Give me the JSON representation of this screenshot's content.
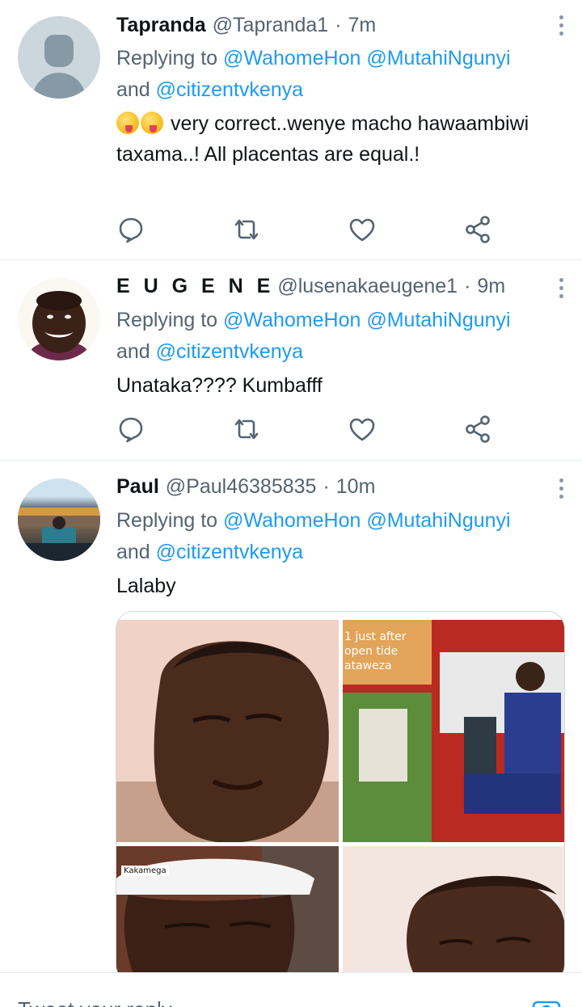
{
  "colors": {
    "accent": "#1d9bf0",
    "muted": "#536471",
    "text": "#0f1419",
    "divider": "#e6ecf0"
  },
  "tweets": [
    {
      "name": "Tapranda",
      "handle": "@Tapranda1",
      "dot": "·",
      "time": "7m",
      "reply_prefix": "Replying to",
      "mention1": "@WahomeHon",
      "mention2": "@MutahiNgunyi",
      "reply_and": "and",
      "mention3": "@citizentvkenya",
      "text": "very correct..wenye macho hawaambiwi taxama..! All placentas are equal.!",
      "emojis": [
        "yum-face-emoji",
        "yum-face-emoji"
      ]
    },
    {
      "name": "E U G E N E",
      "handle": "@lusenakaeugene1",
      "dot": "·",
      "time": "9m",
      "reply_prefix": "Replying to",
      "mention1": "@WahomeHon",
      "mention2": "@MutahiNgunyi",
      "reply_and": "and",
      "mention3": "@citizentvkenya",
      "text": "Unataka???? Kumbafff"
    },
    {
      "name": "Paul",
      "handle": "@Paul46385835",
      "dot": "·",
      "time": "10m",
      "reply_prefix": "Replying to",
      "mention1": "@WahomeHon",
      "mention2": "@MutahiNgunyi",
      "reply_and": "and",
      "mention3": "@citizentvkenya",
      "text": "Lalaby",
      "media_captions": {
        "photo2_line1": "1 just after",
        "photo2_line2": "open tide",
        "photo2_line3": "ataweza",
        "photo3_tag": "Kakamega"
      }
    }
  ],
  "action_icons": [
    "reply-icon",
    "retweet-icon",
    "like-icon",
    "share-icon"
  ],
  "composer": {
    "placeholder": "Tweet your reply",
    "icon": "camera-icon"
  }
}
